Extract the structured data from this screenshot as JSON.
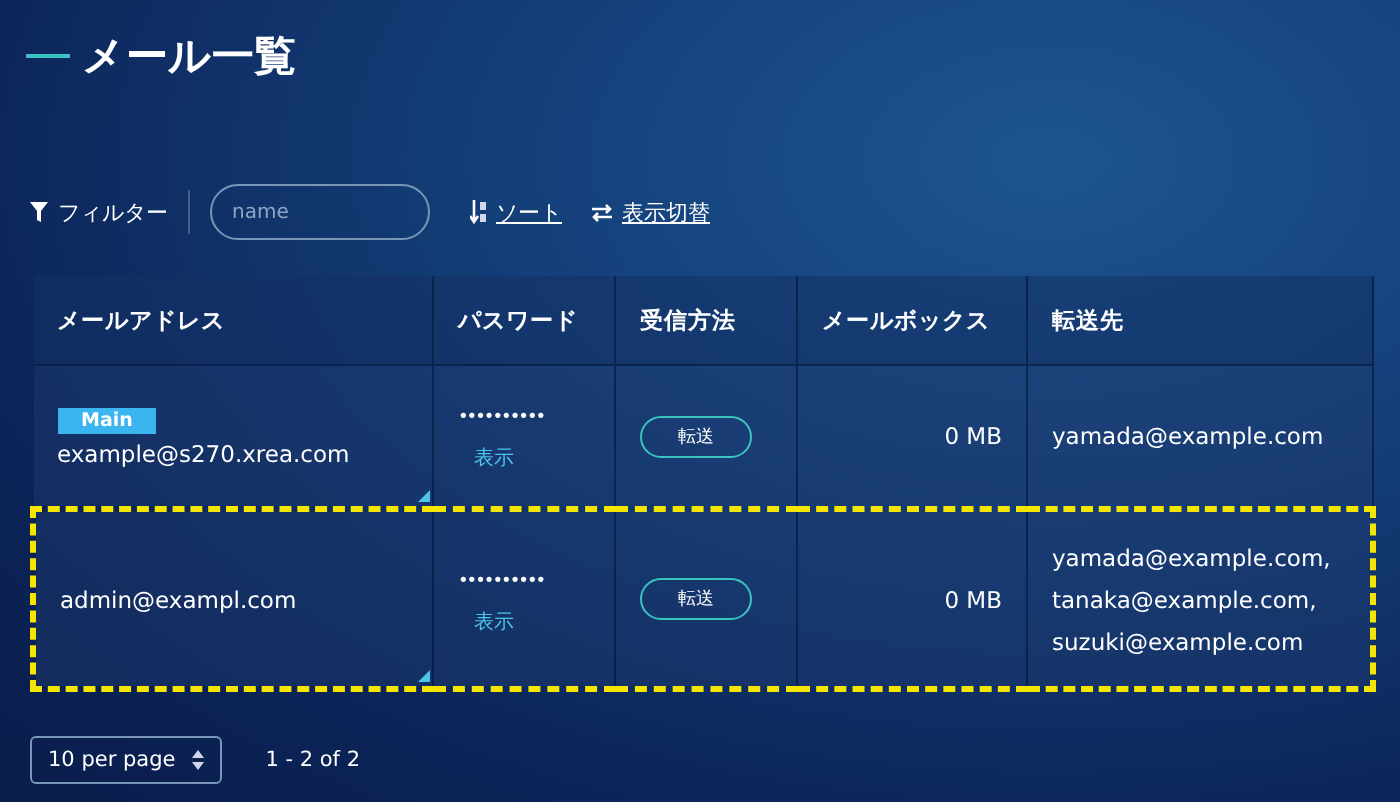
{
  "title": "メール一覧",
  "toolbar": {
    "filter_label": "フィルター",
    "search": {
      "placeholder": "name"
    },
    "sort_link": "ソート",
    "toggle_link": "表示切替"
  },
  "table": {
    "columns": [
      "メールアドレス",
      "パスワード",
      "受信方法",
      "メールボックス",
      "転送先"
    ],
    "rows": [
      {
        "badge": "Main",
        "address": "example@s270.xrea.com",
        "password": "••••••••••",
        "show_link": "表示",
        "method": "転送",
        "mailbox": "0 MB",
        "forward_to": [
          "yamada@example.com"
        ],
        "highlighted": false
      },
      {
        "address": "admin@exampl.com",
        "password": "••••••••••",
        "show_link": "表示",
        "method": "転送",
        "mailbox": "0 MB",
        "forward_to": [
          "yamada@example.com,",
          "tanaka@example.com,",
          "suzuki@example.com"
        ],
        "highlighted": true
      }
    ]
  },
  "footer": {
    "per_page": "10 per page",
    "range": "1 - 2 of 2"
  }
}
